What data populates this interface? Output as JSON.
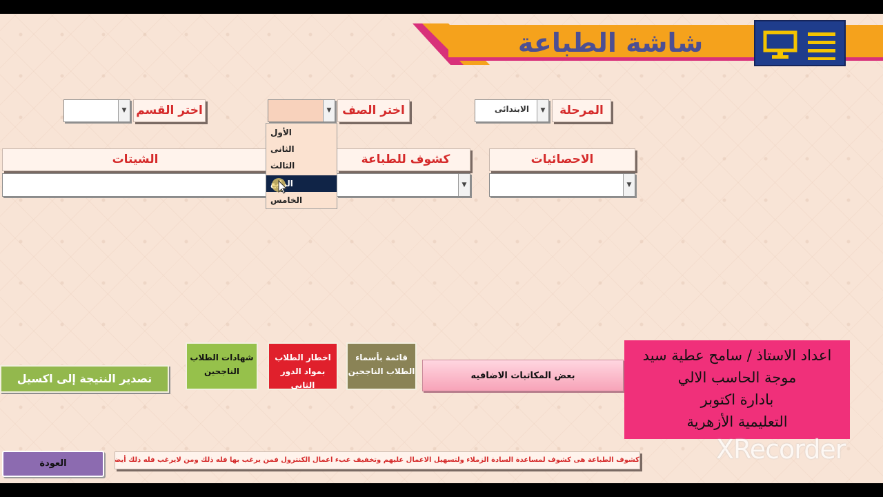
{
  "header": {
    "title": "شاشة الطباعة",
    "menu_icon": "list-monitor-icon"
  },
  "filters": {
    "stage_label": "المرحلة",
    "stage_value": "الابتدائى",
    "grade_label": "اختر الصف",
    "grade_value": "",
    "section_label": "اختر القسم",
    "section_value": ""
  },
  "grade_dropdown": {
    "options": [
      "الأول",
      "الثانى",
      "الثالث",
      "الرابع",
      "الخامس"
    ],
    "highlighted_index": 3
  },
  "panels": {
    "stats_label": "الاحصائيات",
    "print_reports_label": "كشوف للطباعة",
    "sheets_label": "الشيتات"
  },
  "actions": {
    "extra_correspondence": "بعض المكاتبات الاضافيه",
    "passed_list_line1": "قائمة بأسماء",
    "passed_list_line2": "الطلاب الناجحين",
    "notify_line1": "اخطار الطلاب",
    "notify_line2": "بمواد الدور الثانى",
    "certificates_line1": "شهادات الطلاب",
    "certificates_line2": "الناجحين",
    "export_excel": "تصدير النتيجة إلى اكسيل",
    "back": "العودة"
  },
  "footer_note": "كشوف الطباعة هى كشوف لمساعدة السادة الزملاء ولتسهيل الاعمال عليهم وتخفيف عبء اعمال الكنترول فمن يرغب بها فله ذلك ومن لايرغب فله ذلك أيضا",
  "credits": [
    "اعداد الاستاذ / سامح عطية سيد",
    "موجة الحاسب الالي",
    "بادارة اكتوبر",
    "التعليمية الأزهرية"
  ],
  "watermark": "XRecorder",
  "colors": {
    "banner_orange": "#f5a21c",
    "banner_pink": "#d8307a",
    "title_text": "#4c4f93",
    "label_red": "#d52a2a",
    "credits_pink": "#f0307a",
    "export_green": "#93b84d",
    "notify_red": "#e0202c",
    "back_purple": "#8c6bb0"
  }
}
